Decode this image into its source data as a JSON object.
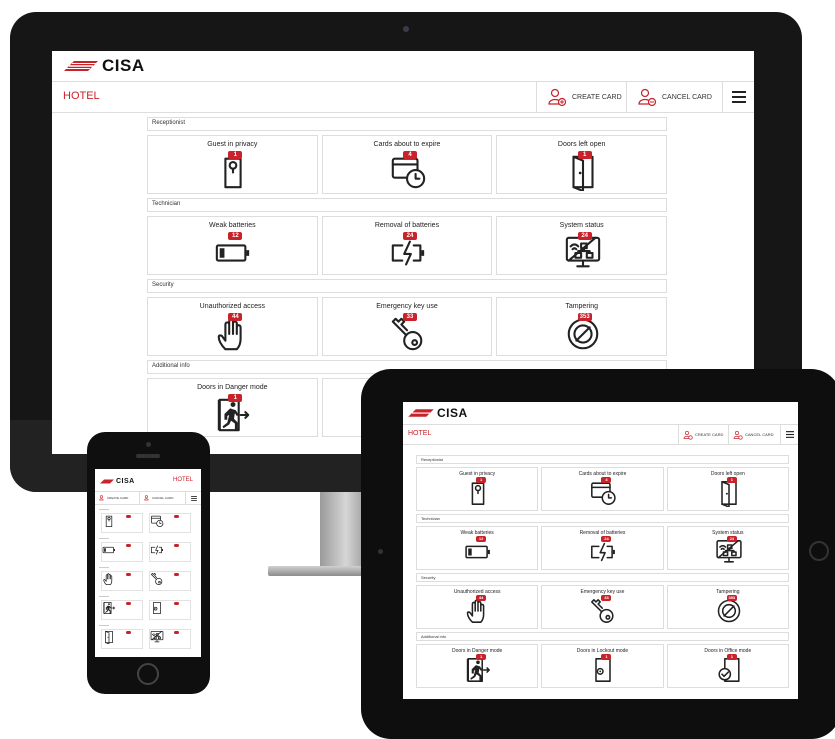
{
  "brand": {
    "logo_text": "CISA",
    "accent": "#c8222b"
  },
  "app": {
    "section_title": "HOTEL"
  },
  "toolbar": {
    "create_card": "CREATE CARD",
    "cancel_card": "CANCEL CARD"
  },
  "sections": [
    {
      "title": "Receptionist",
      "tiles": [
        {
          "label": "Guest in privacy",
          "badge": "1",
          "icon": "door-hanger-icon"
        },
        {
          "label": "Cards about to expire",
          "badge": "4",
          "icon": "card-clock-icon"
        },
        {
          "label": "Doors left open",
          "badge": "1",
          "icon": "open-door-icon"
        }
      ]
    },
    {
      "title": "Technician",
      "tiles": [
        {
          "label": "Weak batteries",
          "badge": "12",
          "icon": "low-battery-icon"
        },
        {
          "label": "Removal of batteries",
          "badge": "24",
          "icon": "battery-removal-icon"
        },
        {
          "label": "System status",
          "badge": "24",
          "icon": "system-status-icon"
        }
      ]
    },
    {
      "title": "Security",
      "tiles": [
        {
          "label": "Unauthorized access",
          "badge": "44",
          "icon": "hand-stop-icon"
        },
        {
          "label": "Emergency key use",
          "badge": "33",
          "icon": "key-icon"
        },
        {
          "label": "Tampering",
          "badge": "353",
          "icon": "prohibited-icon"
        }
      ]
    },
    {
      "title": "Additional info",
      "tiles": [
        {
          "label": "Doors in Danger mode",
          "badge": "1",
          "icon": "emergency-exit-icon"
        },
        {
          "label": "Doors in Lockout mode",
          "badge": "1",
          "icon": "lockout-door-icon"
        },
        {
          "label": "Doors in Office mode",
          "badge": "1",
          "icon": "office-door-icon"
        }
      ]
    }
  ]
}
